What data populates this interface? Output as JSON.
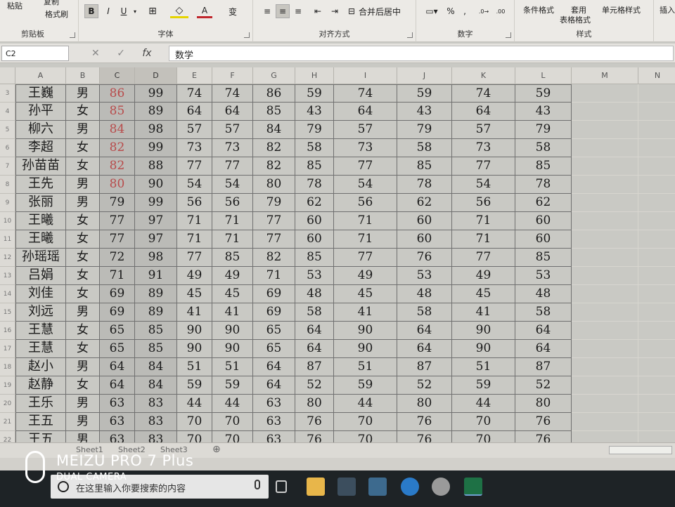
{
  "ribbon": {
    "clipboard": {
      "paste": "粘贴",
      "copy": "复制",
      "format_painter": "格式刷",
      "label": "剪贴板"
    },
    "font": {
      "bold": "B",
      "italic": "I",
      "underline": "U",
      "font_color": "A",
      "phonetic": "变",
      "label": "字体"
    },
    "alignment": {
      "merge_center": "合并后居中",
      "label": "对齐方式"
    },
    "number": {
      "percent": "%",
      "comma": ",",
      "label": "数字"
    },
    "styles": {
      "conditional_format": "条件格式",
      "table_format_top": "套用",
      "table_format_bottom": "表格格式",
      "cell_styles": "单元格样式",
      "label": "样式"
    },
    "insert": "插入"
  },
  "formula_bar": {
    "name_box": "C2",
    "fx": "fx",
    "content": "数学"
  },
  "columns": [
    "A",
    "B",
    "C",
    "D",
    "E",
    "F",
    "G",
    "H",
    "I",
    "J",
    "K",
    "L",
    "M",
    "N"
  ],
  "rows": [
    {
      "num": "3",
      "cells": [
        "王巍",
        "男",
        "86",
        "99",
        "74",
        "74",
        "86",
        "59",
        "74",
        "59",
        "74",
        "59"
      ]
    },
    {
      "num": "4",
      "cells": [
        "孙平",
        "女",
        "85",
        "89",
        "64",
        "64",
        "85",
        "43",
        "64",
        "43",
        "64",
        "43"
      ]
    },
    {
      "num": "5",
      "cells": [
        "柳六",
        "男",
        "84",
        "98",
        "57",
        "57",
        "84",
        "79",
        "57",
        "79",
        "57",
        "79"
      ]
    },
    {
      "num": "6",
      "cells": [
        "李超",
        "女",
        "82",
        "99",
        "73",
        "73",
        "82",
        "58",
        "73",
        "58",
        "73",
        "58"
      ]
    },
    {
      "num": "7",
      "cells": [
        "孙苗苗",
        "女",
        "82",
        "88",
        "77",
        "77",
        "82",
        "85",
        "77",
        "85",
        "77",
        "85"
      ]
    },
    {
      "num": "8",
      "cells": [
        "王先",
        "男",
        "80",
        "90",
        "54",
        "54",
        "80",
        "78",
        "54",
        "78",
        "54",
        "78"
      ]
    },
    {
      "num": "9",
      "cells": [
        "张丽",
        "男",
        "79",
        "99",
        "56",
        "56",
        "79",
        "62",
        "56",
        "62",
        "56",
        "62"
      ]
    },
    {
      "num": "10",
      "cells": [
        "王曦",
        "女",
        "77",
        "97",
        "71",
        "71",
        "77",
        "60",
        "71",
        "60",
        "71",
        "60"
      ]
    },
    {
      "num": "11",
      "cells": [
        "王曦",
        "女",
        "77",
        "97",
        "71",
        "71",
        "77",
        "60",
        "71",
        "60",
        "71",
        "60"
      ]
    },
    {
      "num": "12",
      "cells": [
        "孙瑶瑶",
        "女",
        "72",
        "98",
        "77",
        "85",
        "82",
        "85",
        "77",
        "76",
        "77",
        "85"
      ]
    },
    {
      "num": "13",
      "cells": [
        "吕娟",
        "女",
        "71",
        "91",
        "49",
        "49",
        "71",
        "53",
        "49",
        "53",
        "49",
        "53"
      ]
    },
    {
      "num": "14",
      "cells": [
        "刘佳",
        "女",
        "69",
        "89",
        "45",
        "45",
        "69",
        "48",
        "45",
        "48",
        "45",
        "48"
      ]
    },
    {
      "num": "15",
      "cells": [
        "刘远",
        "男",
        "69",
        "89",
        "41",
        "41",
        "69",
        "58",
        "41",
        "58",
        "41",
        "58"
      ]
    },
    {
      "num": "16",
      "cells": [
        "王慧",
        "女",
        "65",
        "85",
        "90",
        "90",
        "65",
        "64",
        "90",
        "64",
        "90",
        "64"
      ]
    },
    {
      "num": "17",
      "cells": [
        "王慧",
        "女",
        "65",
        "85",
        "90",
        "90",
        "65",
        "64",
        "90",
        "64",
        "90",
        "64"
      ]
    },
    {
      "num": "18",
      "cells": [
        "赵小",
        "男",
        "64",
        "84",
        "51",
        "51",
        "64",
        "87",
        "51",
        "87",
        "51",
        "87"
      ]
    },
    {
      "num": "19",
      "cells": [
        "赵静",
        "女",
        "64",
        "84",
        "59",
        "59",
        "64",
        "52",
        "59",
        "52",
        "59",
        "52"
      ]
    },
    {
      "num": "20",
      "cells": [
        "王乐",
        "男",
        "63",
        "83",
        "44",
        "44",
        "63",
        "80",
        "44",
        "80",
        "44",
        "80"
      ]
    },
    {
      "num": "21",
      "cells": [
        "王五",
        "男",
        "63",
        "83",
        "70",
        "70",
        "63",
        "76",
        "70",
        "76",
        "70",
        "76"
      ]
    },
    {
      "num": "22",
      "cells": [
        "王五",
        "男",
        "63",
        "83",
        "70",
        "70",
        "63",
        "76",
        "70",
        "76",
        "70",
        "76"
      ]
    }
  ],
  "red_rows": 6,
  "sheet_tabs": [
    "Sheet1",
    "Sheet2",
    "Sheet3"
  ],
  "add_sheet": "⊕",
  "taskbar": {
    "search_placeholder": "在这里输入你要搜索的内容"
  },
  "watermark": {
    "title": "MEIZU PRO 7 Plus",
    "subtitle": "DUAL CAMERA"
  },
  "colors": {
    "red_text": "#b84a4a",
    "excel_green": "#1e7145"
  }
}
